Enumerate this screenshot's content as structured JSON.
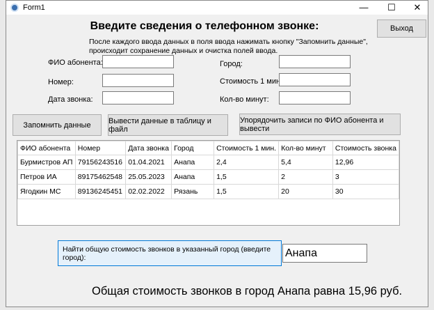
{
  "window": {
    "title": "Form1",
    "minimize": "—",
    "maximize": "☐",
    "close": "✕"
  },
  "header": {
    "title": "Введите сведения о телефонном звонке:",
    "note_line1": "После каждого ввода данных в поля ввода нажимать кнопку \"Запомнить данные\",",
    "note_line2": "происходит сохранение данных и очистка полей ввода.",
    "exit_label": "Выход"
  },
  "form": {
    "fio_label": "ФИО абонента:",
    "number_label": "Номер:",
    "date_label": "Дата звонка:",
    "city_label": "Город:",
    "cost_label": "Стоимость 1 мин:",
    "minutes_label": "Кол-во минут:",
    "fio": "",
    "number": "",
    "date": "",
    "city": "",
    "cost": "",
    "minutes": ""
  },
  "buttons": {
    "save": "Запомнить данные",
    "output": "Вывести данные в таблицу и файл",
    "sort": "Упорядочить записи по ФИО абонента и вывести"
  },
  "table": {
    "columns": [
      "ФИО абонента",
      "Номер",
      "Дата звонка",
      "Город",
      "Стоимость 1 мин.",
      "Кол-во минут",
      "Стоимость звонка"
    ],
    "rows": [
      [
        "Бурмистров АП",
        "79156243516",
        "01.04.2021",
        "Анапа",
        "2,4",
        "5,4",
        "12,96"
      ],
      [
        "Петров ИА",
        "89175462548",
        "25.05.2023",
        "Анапа",
        "1,5",
        "2",
        "3"
      ],
      [
        "Ягодкин МС",
        "89136245451",
        "02.02.2022",
        "Рязань",
        "1,5",
        "20",
        "30"
      ]
    ]
  },
  "search": {
    "button_label": "Найти общую стоимость звонков в указанный город (введите город):",
    "city_value": "Анапа"
  },
  "result": "Общая стоимость звонков в город Анапа равна 15,96 руб.",
  "colors": {
    "accent": "#0078d7",
    "find_bg": "#e5f1fb"
  }
}
